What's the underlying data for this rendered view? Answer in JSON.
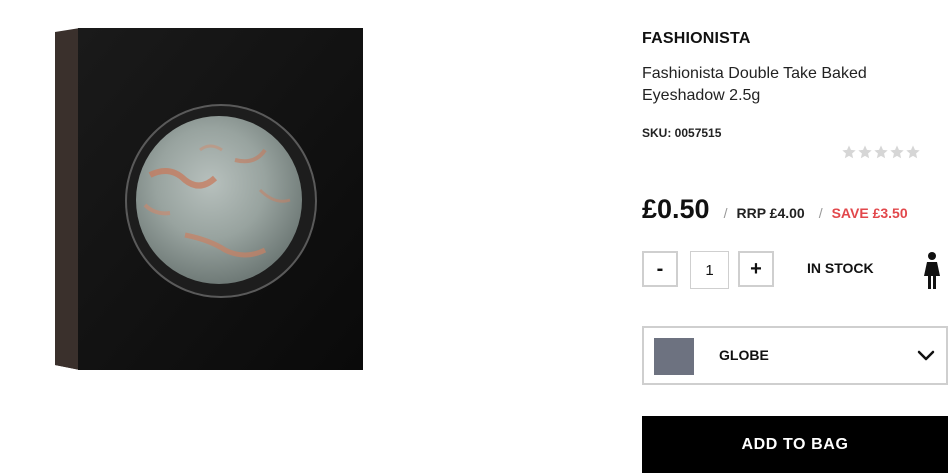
{
  "product": {
    "brand": "FASHIONISTA",
    "title": "Fashionista Double Take Baked Eyeshadow 2.5g",
    "sku": "SKU: 0057515",
    "rating_stars": 0,
    "rating_max": 5
  },
  "pricing": {
    "price": "£0.50",
    "separator": "/",
    "rrp": "RRP £4.00",
    "save": "SAVE £3.50",
    "save_color": "#e2474b"
  },
  "quantity": {
    "minus_label": "-",
    "value": "1",
    "plus_label": "+"
  },
  "stock": {
    "status": "IN STOCK",
    "icon": "person-icon"
  },
  "shade": {
    "selected": "GLOBE",
    "swatch_color": "#6d7280",
    "icon": "chevron-down-icon"
  },
  "cta": {
    "add_to_bag": "ADD TO BAG"
  }
}
